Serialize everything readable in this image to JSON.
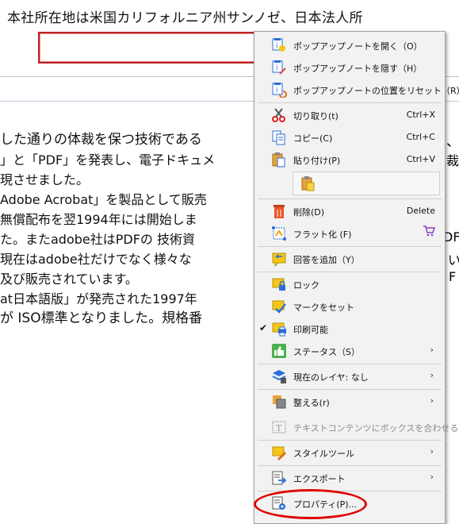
{
  "document": {
    "top_line": "本社所在地は米国カリフォルニア州サンノゼ、日本法人所",
    "lines": [
      "した通りの体裁を保つ技術である",
      "」と「PDF」を発表し、電子ドキュメ",
      "現させました。",
      "Adobe Acrobat」を製品として販売",
      "無償配布を翌1994年には開始しま",
      "た。またadobe社はPDFの 技術資",
      " 現在はadobe社だけでなく様々な",
      "及び販売されています。",
      "at日本語版」が発売された1997年",
      "が ISO標準となりました。規格番"
    ],
    "right_fragments": [
      "、",
      "裁",
      "DF",
      "い",
      "F"
    ]
  },
  "menu": {
    "items": [
      {
        "label": "ポップアップノートを開く（O）",
        "icon": "popup-open-icon"
      },
      {
        "label": "ポップアップノートを隠す（H）",
        "icon": "popup-hide-icon"
      },
      {
        "label": "ポップアップノートの位置をリセット（R）",
        "icon": "popup-reset-icon"
      },
      {
        "label": "切り取り(t)",
        "shortcut": "Ctrl+X",
        "icon": "scissors-icon"
      },
      {
        "label": "コピー(C)",
        "shortcut": "Ctrl+C",
        "icon": "copy-icon"
      },
      {
        "label": "貼り付け(P)",
        "shortcut": "Ctrl+V",
        "icon": "paste-icon"
      },
      {
        "label": "削除(D)",
        "shortcut": "Delete",
        "icon": "trash-icon"
      },
      {
        "label": "フラット化 (F)",
        "icon": "flatten-icon"
      },
      {
        "label": "回答を追加（Y）",
        "icon": "reply-icon"
      },
      {
        "label": "ロック",
        "icon": "lock-note-icon"
      },
      {
        "label": "マークをセット",
        "icon": "mark-icon"
      },
      {
        "label": "印刷可能",
        "icon": "print-icon",
        "checked": true
      },
      {
        "label": "ステータス（S）",
        "icon": "thumbs-up-icon",
        "submenu": true
      },
      {
        "label": "現在のレイヤ: なし",
        "icon": "layer-icon",
        "submenu": true
      },
      {
        "label": "整える(r)",
        "icon": "arrange-icon",
        "submenu": true
      },
      {
        "label": "テキストコンテンツにボックスを合わせる",
        "icon": "fit-text-icon",
        "disabled": true
      },
      {
        "label": "スタイルツール",
        "icon": "style-tool-icon",
        "submenu": true
      },
      {
        "label": "エクスポート",
        "icon": "export-icon",
        "submenu": true
      },
      {
        "label": "プロパティ(P)...",
        "icon": "properties-icon"
      }
    ],
    "submenu_arrow": "›",
    "check_mark": "✔",
    "cart_icon": "cart-icon"
  },
  "colors": {
    "highlight": "#e00000",
    "menu_bg": "#f2f2f2",
    "icon_yellow": "#f5c518",
    "icon_blue": "#2a6fd6"
  }
}
